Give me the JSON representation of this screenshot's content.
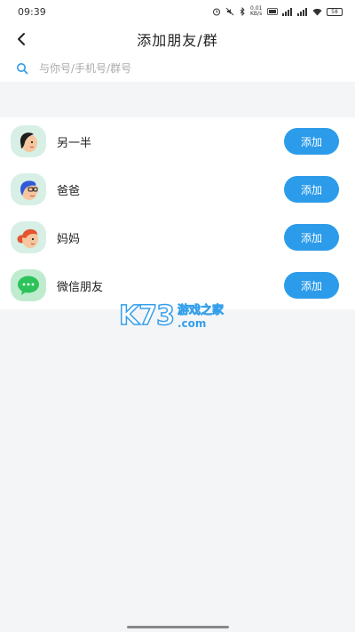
{
  "status": {
    "time": "09:39",
    "network_speed": "0.01 KB/s",
    "battery": "58"
  },
  "header": {
    "title": "添加朋友/群"
  },
  "search": {
    "placeholder": "与你号/手机号/群号"
  },
  "contacts": [
    {
      "label": "另一半",
      "button": "添加",
      "icon": "woman-dark-hair-avatar",
      "bg": "#d7efe5"
    },
    {
      "label": "爸爸",
      "button": "添加",
      "icon": "man-glasses-avatar",
      "bg": "#d7efe5"
    },
    {
      "label": "妈妈",
      "button": "添加",
      "icon": "woman-red-hair-avatar",
      "bg": "#d7efe5"
    },
    {
      "label": "微信朋友",
      "button": "添加",
      "icon": "wechat-icon",
      "bg": "#cfe9dc"
    }
  ],
  "watermark": {
    "brand": "K73",
    "cn": "游戏之家",
    "domain": ".com"
  },
  "colors": {
    "accent": "#2b9bea",
    "background": "#f4f5f7"
  }
}
